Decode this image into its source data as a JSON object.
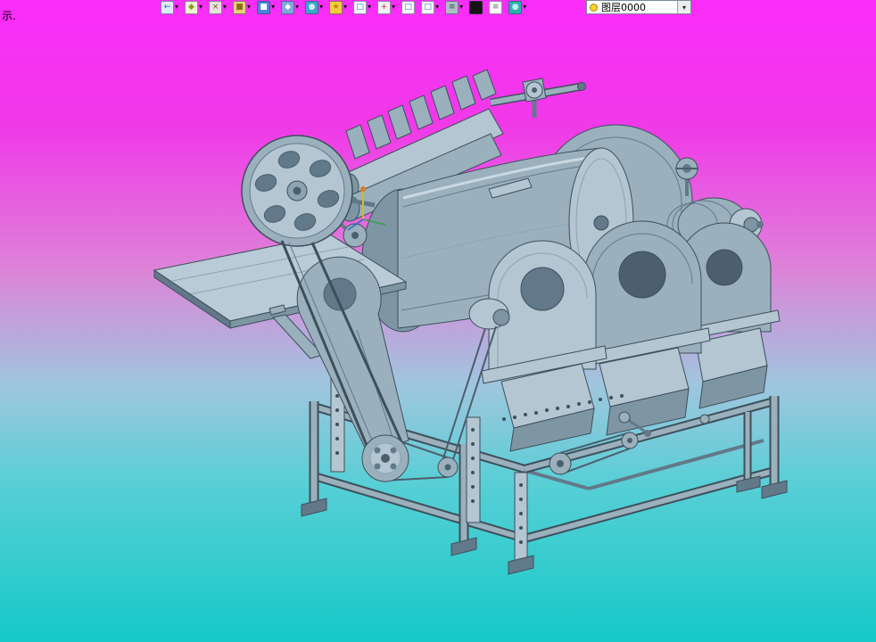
{
  "app": {
    "hint_text": "示."
  },
  "toolbar": {
    "icons": [
      {
        "name": "open-drawing-icon",
        "glyph": "←",
        "bg": "#dcebf7",
        "fg": "#1a5fc0",
        "dropdown": true
      },
      {
        "name": "render-mode-icon",
        "glyph": "◆",
        "bg": "#eef3d2",
        "fg": "#8a9a20",
        "dropdown": true
      },
      {
        "name": "tool-axe-icon",
        "glyph": "×",
        "bg": "#e8e3da",
        "fg": "#7a4a2a",
        "dropdown": true
      },
      {
        "name": "solid-box-icon",
        "glyph": "■",
        "bg": "#e6d27c",
        "fg": "#8a6d1a",
        "dropdown": true
      },
      {
        "name": "cube-blue-icon",
        "glyph": "■",
        "bg": "#4d82d8",
        "fg": "#ffffff",
        "dropdown": true
      },
      {
        "name": "cube-steel-icon",
        "glyph": "◆",
        "bg": "#7ea8d8",
        "fg": "#ffffff",
        "dropdown": true
      },
      {
        "name": "sphere-icon",
        "glyph": "●",
        "bg": "#39a8c8",
        "fg": "#cfeef8",
        "dropdown": true
      },
      {
        "name": "gear-flower-icon",
        "glyph": "★",
        "bg": "#f0cc3e",
        "fg": "#b8860a",
        "dropdown": true
      },
      {
        "name": "clipboard-icon",
        "glyph": "□",
        "bg": "#f5f8fb",
        "fg": "#3a6fc0",
        "dropdown": true
      },
      {
        "name": "target-icon",
        "glyph": "+",
        "bg": "#eef2f5",
        "fg": "#c03030",
        "dropdown": true
      },
      {
        "name": "dialog-icon",
        "glyph": "□",
        "bg": "#f8fafc",
        "fg": "#3a6fc0",
        "dropdown": false
      },
      {
        "name": "window-icon",
        "glyph": "□",
        "bg": "#f8fafc",
        "fg": "#3a6fc0",
        "dropdown": true
      },
      {
        "name": "keyboard-icon",
        "glyph": "≡",
        "bg": "#aebfca",
        "fg": "#3a4a55",
        "dropdown": true
      },
      {
        "name": "black-bar-icon",
        "glyph": "",
        "bg": "#141414",
        "fg": "#141414",
        "dropdown": false
      },
      {
        "name": "document-icon",
        "glyph": "≡",
        "bg": "#ffffff",
        "fg": "#5a6a75",
        "dropdown": false
      },
      {
        "name": "teal-sphere-icon",
        "glyph": "●",
        "bg": "#2bb2ae",
        "fg": "#bfecea",
        "dropdown": true
      }
    ],
    "layer_combo": {
      "value": "图层0000"
    }
  },
  "viewport": {
    "machine_body_color": "#9ab0bd",
    "background_top": "#fa2cfa",
    "background_bottom": "#15c9c8"
  }
}
